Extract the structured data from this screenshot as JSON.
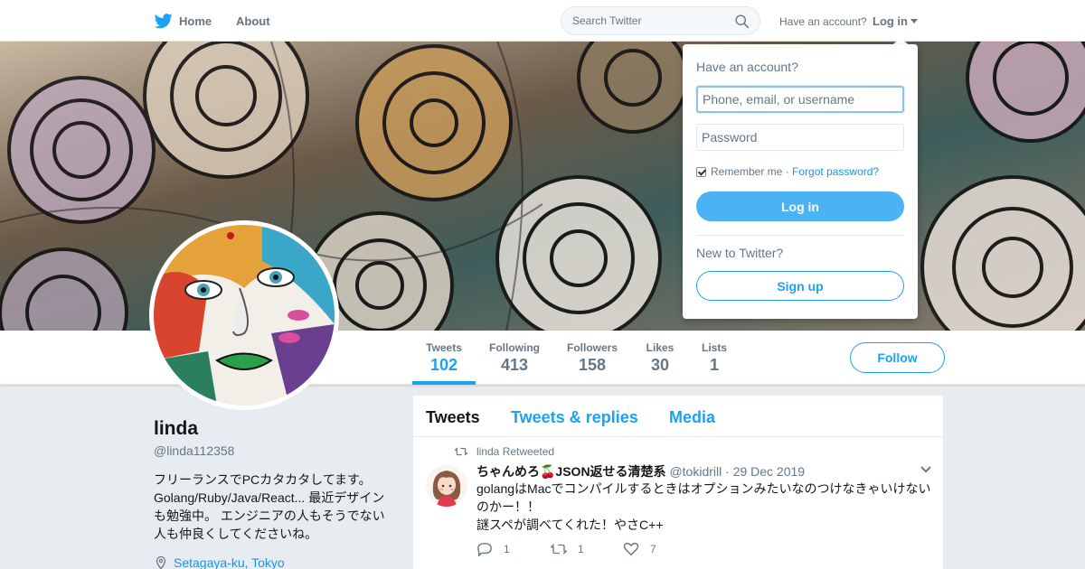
{
  "topbar": {
    "home_label": "Home",
    "about_label": "About",
    "search_placeholder": "Search Twitter",
    "have_account": "Have an account?",
    "login_label": "Log in",
    "icons": {
      "logo": "twitter-bird-icon",
      "search": "search-icon",
      "caret": "caret-down-icon"
    }
  },
  "profile": {
    "name": "linda",
    "handle": "@linda112358",
    "bio": "フリーランスでPCカタカタしてます。Golang/Ruby/Java/React... 最近デザインも勉強中。 エンジニアの人もそうでない人も仲良くしてくださいね。",
    "location": "Setagaya-ku, Tokyo"
  },
  "stats": [
    {
      "label": "Tweets",
      "value": "102",
      "active": true
    },
    {
      "label": "Following",
      "value": "413"
    },
    {
      "label": "Followers",
      "value": "158"
    },
    {
      "label": "Likes",
      "value": "30"
    },
    {
      "label": "Lists",
      "value": "1"
    }
  ],
  "follow_label": "Follow",
  "timeline": {
    "tabs": [
      "Tweets",
      "Tweets & replies",
      "Media"
    ],
    "tweet": {
      "context": "linda Retweeted",
      "fullname": "ちゃんめろ🍒JSON返せる清楚系",
      "username": "@tokidrill",
      "separator": "·",
      "date": "29 Dec 2019",
      "line1": "golangはMacでコンパイルするときはオプションみたいなのつけなきゃいけないのかー！！",
      "line2": "謎スペが調べてくれた！やさC++",
      "replies": "1",
      "retweets": "1",
      "likes": "7"
    }
  },
  "login_dropdown": {
    "title": "Have an account?",
    "username_placeholder": "Phone, email, or username",
    "password_placeholder": "Password",
    "remember": "Remember me",
    "dot": "·",
    "forgot": "Forgot password?",
    "login_button": "Log in",
    "new_to": "New to Twitter?",
    "signup_button": "Sign up"
  },
  "colors": {
    "accent": "#1da1f2",
    "login_button": "#4ab3f4",
    "background": "#e6ecf0"
  }
}
